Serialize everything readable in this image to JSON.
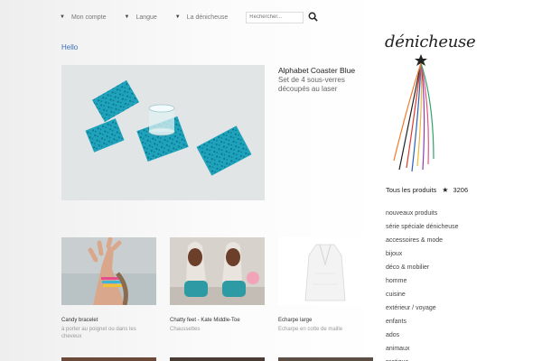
{
  "nav": {
    "items": [
      {
        "label": "Mon compte"
      },
      {
        "label": "Langue"
      },
      {
        "label": "La dénicheuse"
      }
    ],
    "search_placeholder": "Rechercher..."
  },
  "hello": "Hello",
  "featured": {
    "title": "Alphabet Coaster Blue",
    "subtitle": "Set de 4 sous-verres découpés au laser"
  },
  "products": [
    {
      "name": "Candy bracelet",
      "desc": "à porter au poignet ou dans les cheveux"
    },
    {
      "name": "Chatty feet - Kate Middle-Toe",
      "desc": "Chaussettes"
    },
    {
      "name": "Echarpe large",
      "desc": "Echarpe en cotte de maille"
    }
  ],
  "sidebar": {
    "logo": "dénicheuse",
    "all_products_label": "Tous les produits",
    "all_products_count": "3206",
    "categories": [
      "nouveaux produits",
      "série spéciale dénicheuse",
      "accessoires & mode",
      "bijoux",
      "déco & mobilier",
      "homme",
      "cuisine",
      "extérieur / voyage",
      "enfants",
      "ados",
      "animaux",
      "pratique"
    ]
  },
  "colors": {
    "link": "#3b6fb6",
    "coaster": "#1fa3bc"
  }
}
